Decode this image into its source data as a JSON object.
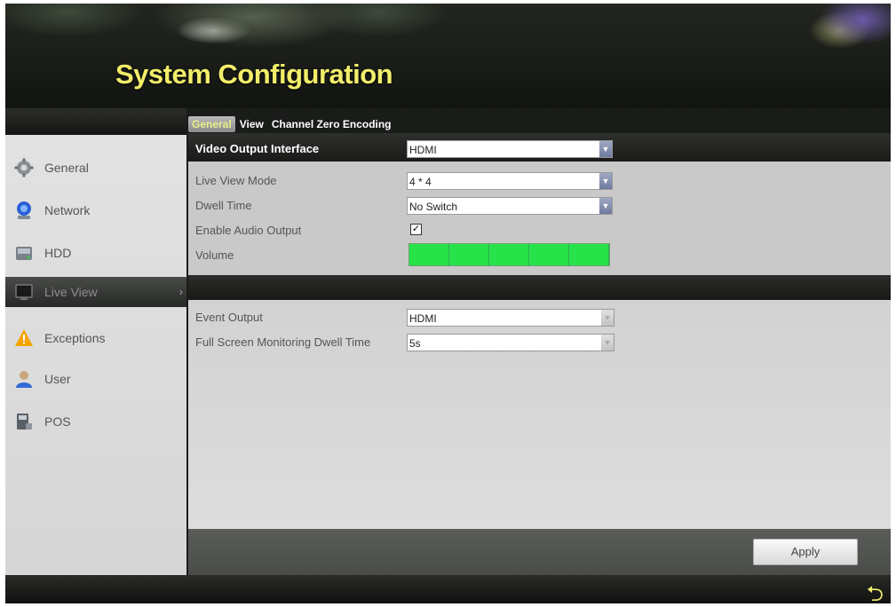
{
  "header": {
    "title": "System Configuration"
  },
  "tabs": [
    {
      "label": "General",
      "active": true
    },
    {
      "label": "View",
      "active": false
    },
    {
      "label": "Channel Zero Encoding",
      "active": false
    }
  ],
  "sidebar": {
    "items": [
      {
        "label": "General",
        "icon": "gear-icon"
      },
      {
        "label": "Network",
        "icon": "network-globe-icon"
      },
      {
        "label": "HDD",
        "icon": "hdd-icon"
      },
      {
        "label": "Live View",
        "icon": "monitor-icon",
        "active": true
      },
      {
        "label": "Exceptions",
        "icon": "warning-icon"
      },
      {
        "label": "User",
        "icon": "user-icon"
      },
      {
        "label": "POS",
        "icon": "pos-terminal-icon"
      }
    ]
  },
  "form": {
    "video_output_interface": {
      "label": "Video Output Interface",
      "value": "HDMI"
    },
    "live_view_mode": {
      "label": "Live View Mode",
      "value": "4 * 4"
    },
    "dwell_time": {
      "label": "Dwell Time",
      "value": "No Switch"
    },
    "enable_audio_output": {
      "label": "Enable Audio Output",
      "checked": true,
      "mark": "✓"
    },
    "volume": {
      "label": "Volume",
      "level_fraction": 1.0,
      "segments": 5
    },
    "event_output": {
      "label": "Event Output",
      "value": "HDMI"
    },
    "full_screen_dwell": {
      "label": "Full Screen Monitoring Dwell Time",
      "value": "5s"
    }
  },
  "footer": {
    "apply_label": "Apply"
  },
  "colors": {
    "title": "#f3ee6a",
    "volume_fill": "#27e34a",
    "accent_arrow": "#6f7aa0"
  }
}
